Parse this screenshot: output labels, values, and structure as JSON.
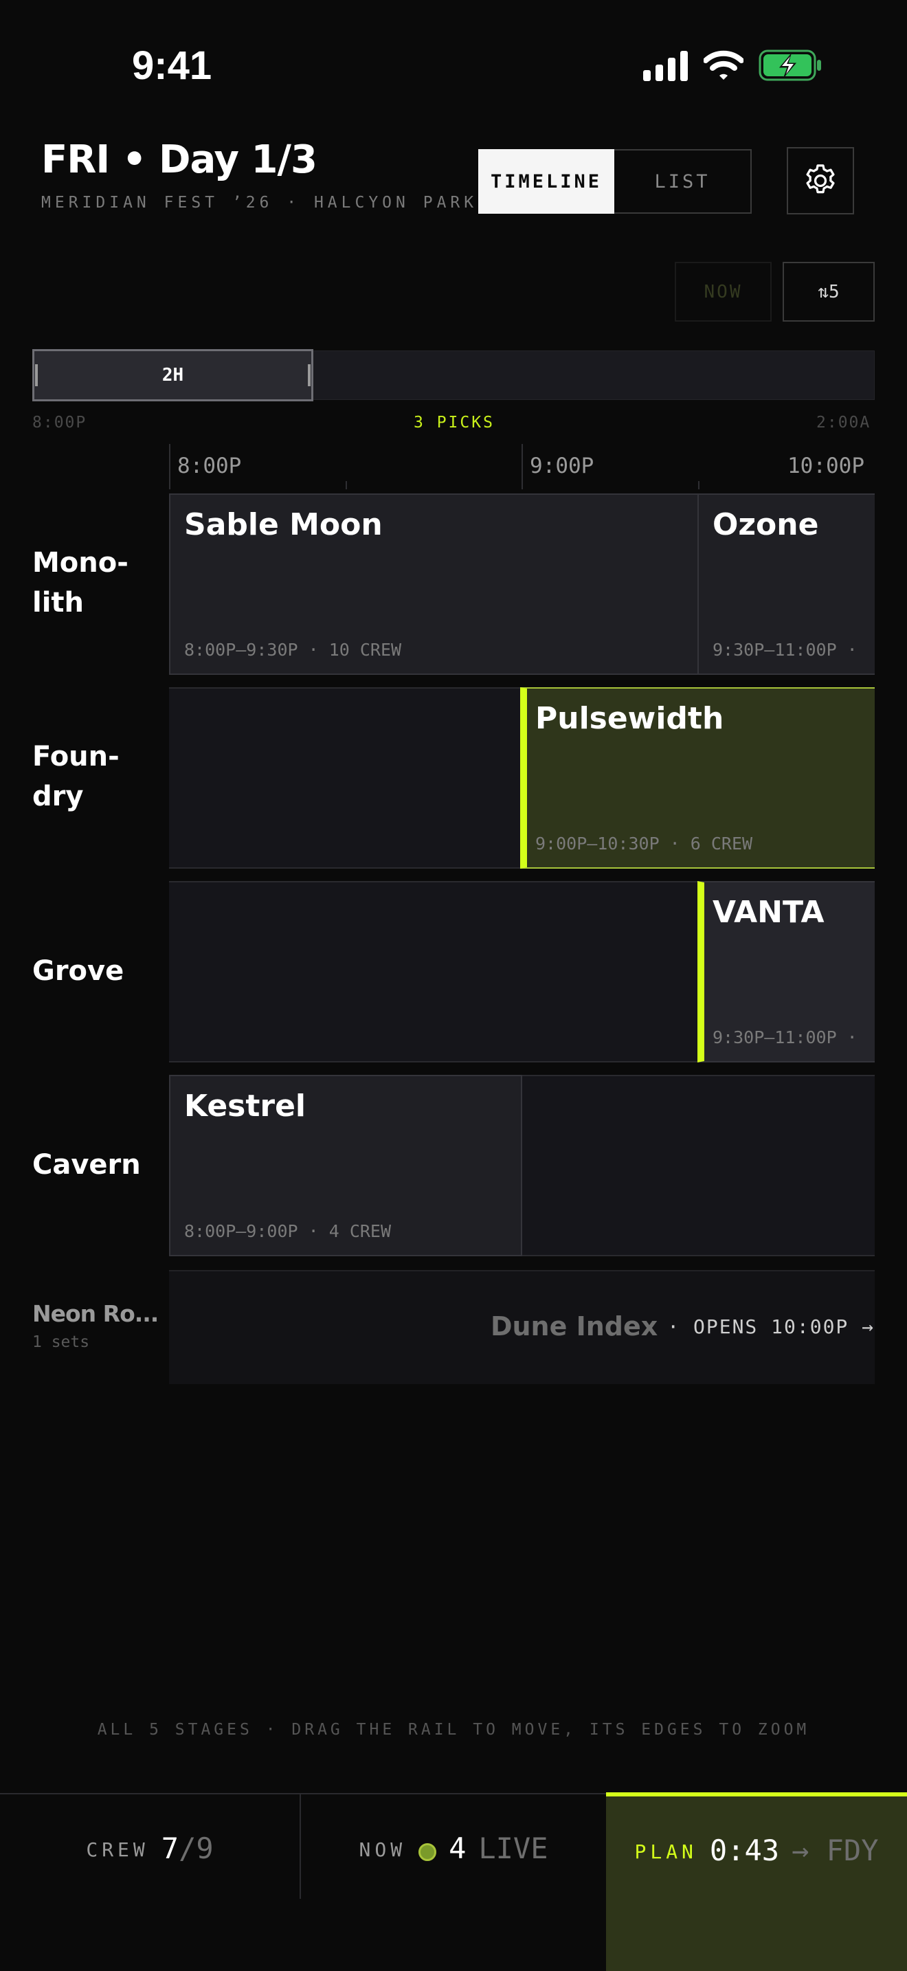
{
  "status_bar": {
    "time": "9:41"
  },
  "header": {
    "title": "FRI • Day 1/3",
    "subtitle": "MERIDIAN FEST ’26 · HALCYON PARK"
  },
  "view_toggle": {
    "timeline": "TIMELINE",
    "list": "LIST",
    "selected": "TIMELINE"
  },
  "toolbar": {
    "now_label": "NOW",
    "sort_label": "⇅5"
  },
  "rail": {
    "window_label": "2H",
    "start": "8:00P",
    "picks": "3 PICKS",
    "end": "2:00A"
  },
  "time_axis": [
    "8:00P",
    "9:00P",
    "10:00P"
  ],
  "stages": [
    {
      "name": "Mono-\nlith",
      "sets": [
        {
          "name": "Sable Moon",
          "meta": "8:00P–9:30P · 10 CREW",
          "pick": false
        },
        {
          "name": "Ozone",
          "meta": "9:30P–11:00P ·",
          "pick": false
        }
      ]
    },
    {
      "name": "Foun-\ndry",
      "sets": [
        {
          "name": "Pulsewidth",
          "meta": "9:00P–10:30P · 6 CREW",
          "pick": true
        }
      ]
    },
    {
      "name": "Grove",
      "sets": [
        {
          "name": "VANTA",
          "meta": "9:30P–11:00P ·",
          "pick": true
        }
      ]
    },
    {
      "name": "Cavern",
      "sets": [
        {
          "name": "Kestrel",
          "meta": "8:00P–9:00P · 4 CREW",
          "pick": false
        }
      ]
    }
  ],
  "collapsed_stage": {
    "name": "Neon Ro...",
    "sets_count": "1 sets",
    "next_set": "Dune Index",
    "opens": "· OPENS 10:00P →"
  },
  "hint": "ALL 5 STAGES · DRAG THE RAIL TO MOVE, ITS EDGES TO ZOOM",
  "tabs": {
    "crew": {
      "label": "CREW",
      "value": "7",
      "total": "/9"
    },
    "now": {
      "label": "NOW",
      "value": "4",
      "suffix": "LIVE"
    },
    "plan": {
      "label": "PLAN",
      "value": "0:43",
      "suffix": "→ FDY"
    }
  },
  "colors": {
    "accent": "#d4ff1a",
    "pick_bg": "#2f361b",
    "background": "#0a0a0a"
  },
  "icons": {
    "settings": "gear-icon",
    "signal": "cellular-signal-icon",
    "wifi": "wifi-icon",
    "battery": "battery-charging-icon"
  }
}
